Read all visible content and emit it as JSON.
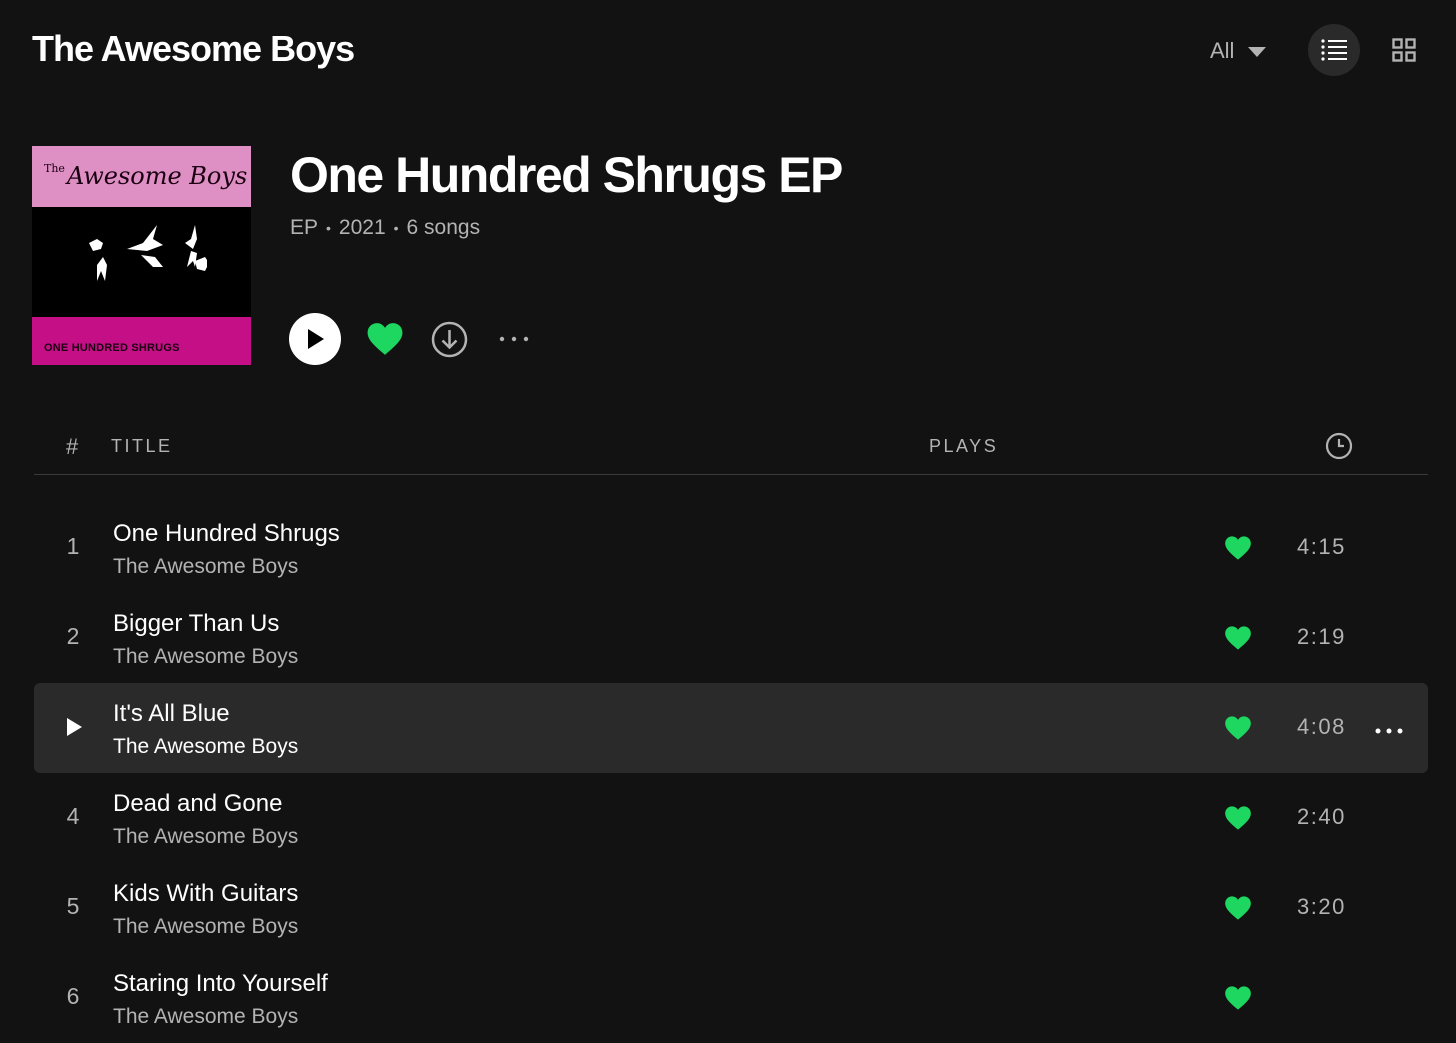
{
  "header": {
    "artist_title": "The Awesome Boys",
    "filter_label": "All"
  },
  "album": {
    "title": "One Hundred Shrugs EP",
    "type": "EP",
    "year": "2021",
    "song_count": "6 songs",
    "cover": {
      "logo_the": "The",
      "logo_text": "Awesome Boys",
      "caption": "ONE HUNDRED SHRUGS"
    }
  },
  "list_header": {
    "number": "#",
    "title": "TITLE",
    "plays": "PLAYS"
  },
  "tracks": [
    {
      "number": "1",
      "title": "One Hundred Shrugs",
      "artist": "The Awesome Boys",
      "duration": "4:15",
      "liked": true
    },
    {
      "number": "2",
      "title": "Bigger Than Us",
      "artist": "The Awesome Boys",
      "duration": "2:19",
      "liked": true
    },
    {
      "number": "3",
      "title": "It's All Blue",
      "artist": "The Awesome Boys",
      "duration": "4:08",
      "liked": true,
      "hovered": true
    },
    {
      "number": "4",
      "title": "Dead and Gone",
      "artist": "The Awesome Boys",
      "duration": "2:40",
      "liked": true
    },
    {
      "number": "5",
      "title": "Kids With Guitars",
      "artist": "The Awesome Boys",
      "duration": "3:20",
      "liked": true
    },
    {
      "number": "6",
      "title": "Staring Into Yourself",
      "artist": "The Awesome Boys",
      "duration": "",
      "liked": true
    }
  ],
  "icons": {
    "filter": "chevron-down-icon",
    "list_view": "list-view-icon",
    "grid_view": "grid-view-icon",
    "play": "play-icon",
    "like": "heart-icon",
    "download": "download-icon",
    "more": "more-icon",
    "duration": "clock-icon"
  },
  "colors": {
    "background": "#121212",
    "accent": "#1ed760",
    "text_primary": "#ffffff",
    "text_secondary": "#b3b3b3",
    "row_hover": "#2a2a2a",
    "cover_pink": "#de8fc4",
    "cover_magenta": "#c40f86"
  }
}
